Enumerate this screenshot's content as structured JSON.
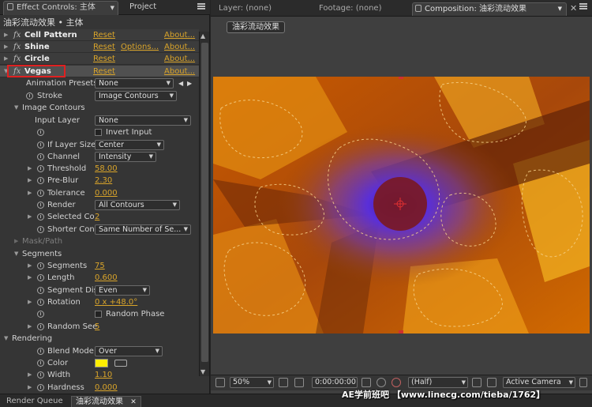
{
  "left_tabs": {
    "effect_controls": "Effect Controls: 主体",
    "project": "Project"
  },
  "panel_header": "油彩流动效果 • 主体",
  "effects": [
    {
      "name": "Cell Pattern",
      "reset": "Reset",
      "about": "About..."
    },
    {
      "name": "Shine",
      "reset": "Reset",
      "options": "Options...",
      "about": "About..."
    },
    {
      "name": "Circle",
      "reset": "Reset",
      "about": "About..."
    },
    {
      "name": "Vegas",
      "reset": "Reset",
      "about": "About..."
    }
  ],
  "fx_symbol": "fx",
  "props": {
    "animation_presets": {
      "label": "Animation Presets:",
      "value": "None"
    },
    "stroke": {
      "label": "Stroke",
      "value": "Image Contours"
    },
    "image_contours": "Image Contours",
    "input_layer": {
      "label": "Input Layer",
      "value": "None"
    },
    "invert_input": "Invert Input",
    "if_layer_size": {
      "label": "If Layer Size",
      "value": "Center"
    },
    "channel": {
      "label": "Channel",
      "value": "Intensity"
    },
    "threshold": {
      "label": "Threshold",
      "value": "58.00"
    },
    "pre_blur": {
      "label": "Pre-Blur",
      "value": "2.30"
    },
    "tolerance": {
      "label": "Tolerance",
      "value": "0.000"
    },
    "render": {
      "label": "Render",
      "value": "All Contours"
    },
    "selected_co": {
      "label": "Selected Co",
      "value": "2"
    },
    "shorter_cont": {
      "label": "Shorter Cont",
      "value": "Same Number of Se..."
    },
    "mask_path": "Mask/Path",
    "segments_group": "Segments",
    "segments": {
      "label": "Segments",
      "value": "75"
    },
    "length": {
      "label": "Length",
      "value": "0.600"
    },
    "segment_dis": {
      "label": "Segment Dis",
      "value": "Even"
    },
    "rotation": {
      "label": "Rotation",
      "value": "0 x +48.0°"
    },
    "random_phase": "Random Phase",
    "random_see": {
      "label": "Random See",
      "value": "5"
    },
    "rendering_group": "Rendering",
    "blend_mode": {
      "label": "Blend Mode",
      "value": "Over"
    },
    "color": {
      "label": "Color",
      "swatch": "#ffee00"
    },
    "width": {
      "label": "Width",
      "value": "1.10"
    },
    "hardness": {
      "label": "Hardness",
      "value": "0.000"
    }
  },
  "right_tabs": {
    "layer": "Layer: (none)",
    "footage": "Footage: (none)",
    "composition": "Composition: 油彩流动效果"
  },
  "comp_button": "油彩流动效果",
  "toolbar": {
    "zoom": "50%",
    "timecode": "0:00:00:00",
    "resolution": "(Half)",
    "camera": "Active Camera"
  },
  "bottom_tabs": {
    "render_queue": "Render Queue",
    "comp": "油彩流动效果"
  },
  "watermark": "AE学前班吧 【www.linecg.com/tieba/1762】"
}
